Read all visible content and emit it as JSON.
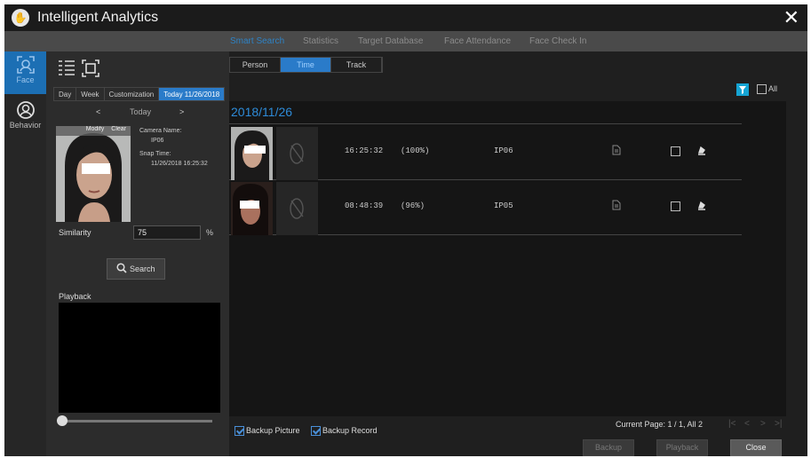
{
  "app": {
    "title": "Intelligent Analytics",
    "close_label": "✕"
  },
  "tabs": [
    {
      "label": "Smart Search",
      "active": true
    },
    {
      "label": "Statistics"
    },
    {
      "label": "Target Database"
    },
    {
      "label": "Face Attendance"
    },
    {
      "label": "Face Check In"
    }
  ],
  "leftnav": {
    "items": [
      {
        "label": "Face",
        "icon": "face-icon",
        "active": true
      },
      {
        "label": "Behavior",
        "icon": "behavior-icon"
      }
    ]
  },
  "panel": {
    "day_tabs": [
      "Day",
      "Week",
      "Customization",
      "Today 11/26/2018"
    ],
    "date_nav": {
      "prev": "<",
      "label": "Today",
      "next": ">"
    },
    "photo_actions": [
      "Modify",
      "Clear"
    ],
    "camera_name_label": "Camera Name:",
    "camera_name": "IP06",
    "snap_time_label": "Snap Time:",
    "snap_time": "11/26/2018 16:25:32",
    "similarity_label": "Similarity",
    "similarity_value": "75",
    "similarity_unit": "%",
    "search_label": "Search",
    "playback_label": "Playback"
  },
  "main": {
    "sub_tabs": [
      {
        "label": "Person"
      },
      {
        "label": "Time",
        "active": true
      },
      {
        "label": "Track"
      }
    ],
    "all_label": "All",
    "date_header": "2018/11/26",
    "rows": [
      {
        "time": "16:25:32",
        "similarity": "(100%)",
        "camera": "IP06"
      },
      {
        "time": "08:48:39",
        "similarity": "(96%)",
        "camera": "IP05"
      }
    ],
    "backup_picture": "Backup Picture",
    "backup_record": "Backup Record",
    "page_info": "Current Page: 1 / 1, All 2",
    "buttons": {
      "backup": "Backup",
      "playback": "Playback",
      "close": "Close"
    }
  },
  "colors": {
    "accent": "#2a7bc9",
    "filter": "#15a4d3"
  }
}
